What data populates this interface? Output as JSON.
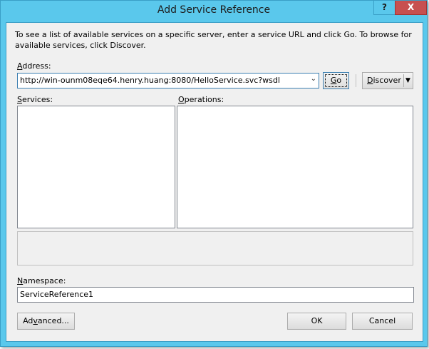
{
  "window": {
    "title": "Add Service Reference",
    "help_label": "?",
    "close_label": "X"
  },
  "intro_text": "To see a list of available services on a specific server, enter a service URL and click Go. To browse for available services, click Discover.",
  "address": {
    "label_access": "A",
    "label_rest": "ddress:",
    "value": "http://win-ounm08eqe64.henry.huang:8080/HelloService.svc?wsdl",
    "dropdown_icon": "chevron-down-icon"
  },
  "go_button": {
    "access": "G",
    "rest": "o"
  },
  "discover_button": {
    "access": "D",
    "rest": "iscover",
    "menu_icon": "triangle-down-icon"
  },
  "services": {
    "label_access": "S",
    "label_rest": "ervices:"
  },
  "operations": {
    "label_access": "O",
    "label_rest": "perations:"
  },
  "namespace": {
    "label_access": "N",
    "label_rest": "amespace:",
    "value": "ServiceReference1"
  },
  "footer": {
    "advanced_pre": "Ad",
    "advanced_access": "v",
    "advanced_post": "anced...",
    "ok_label": "OK",
    "cancel_label": "Cancel"
  }
}
